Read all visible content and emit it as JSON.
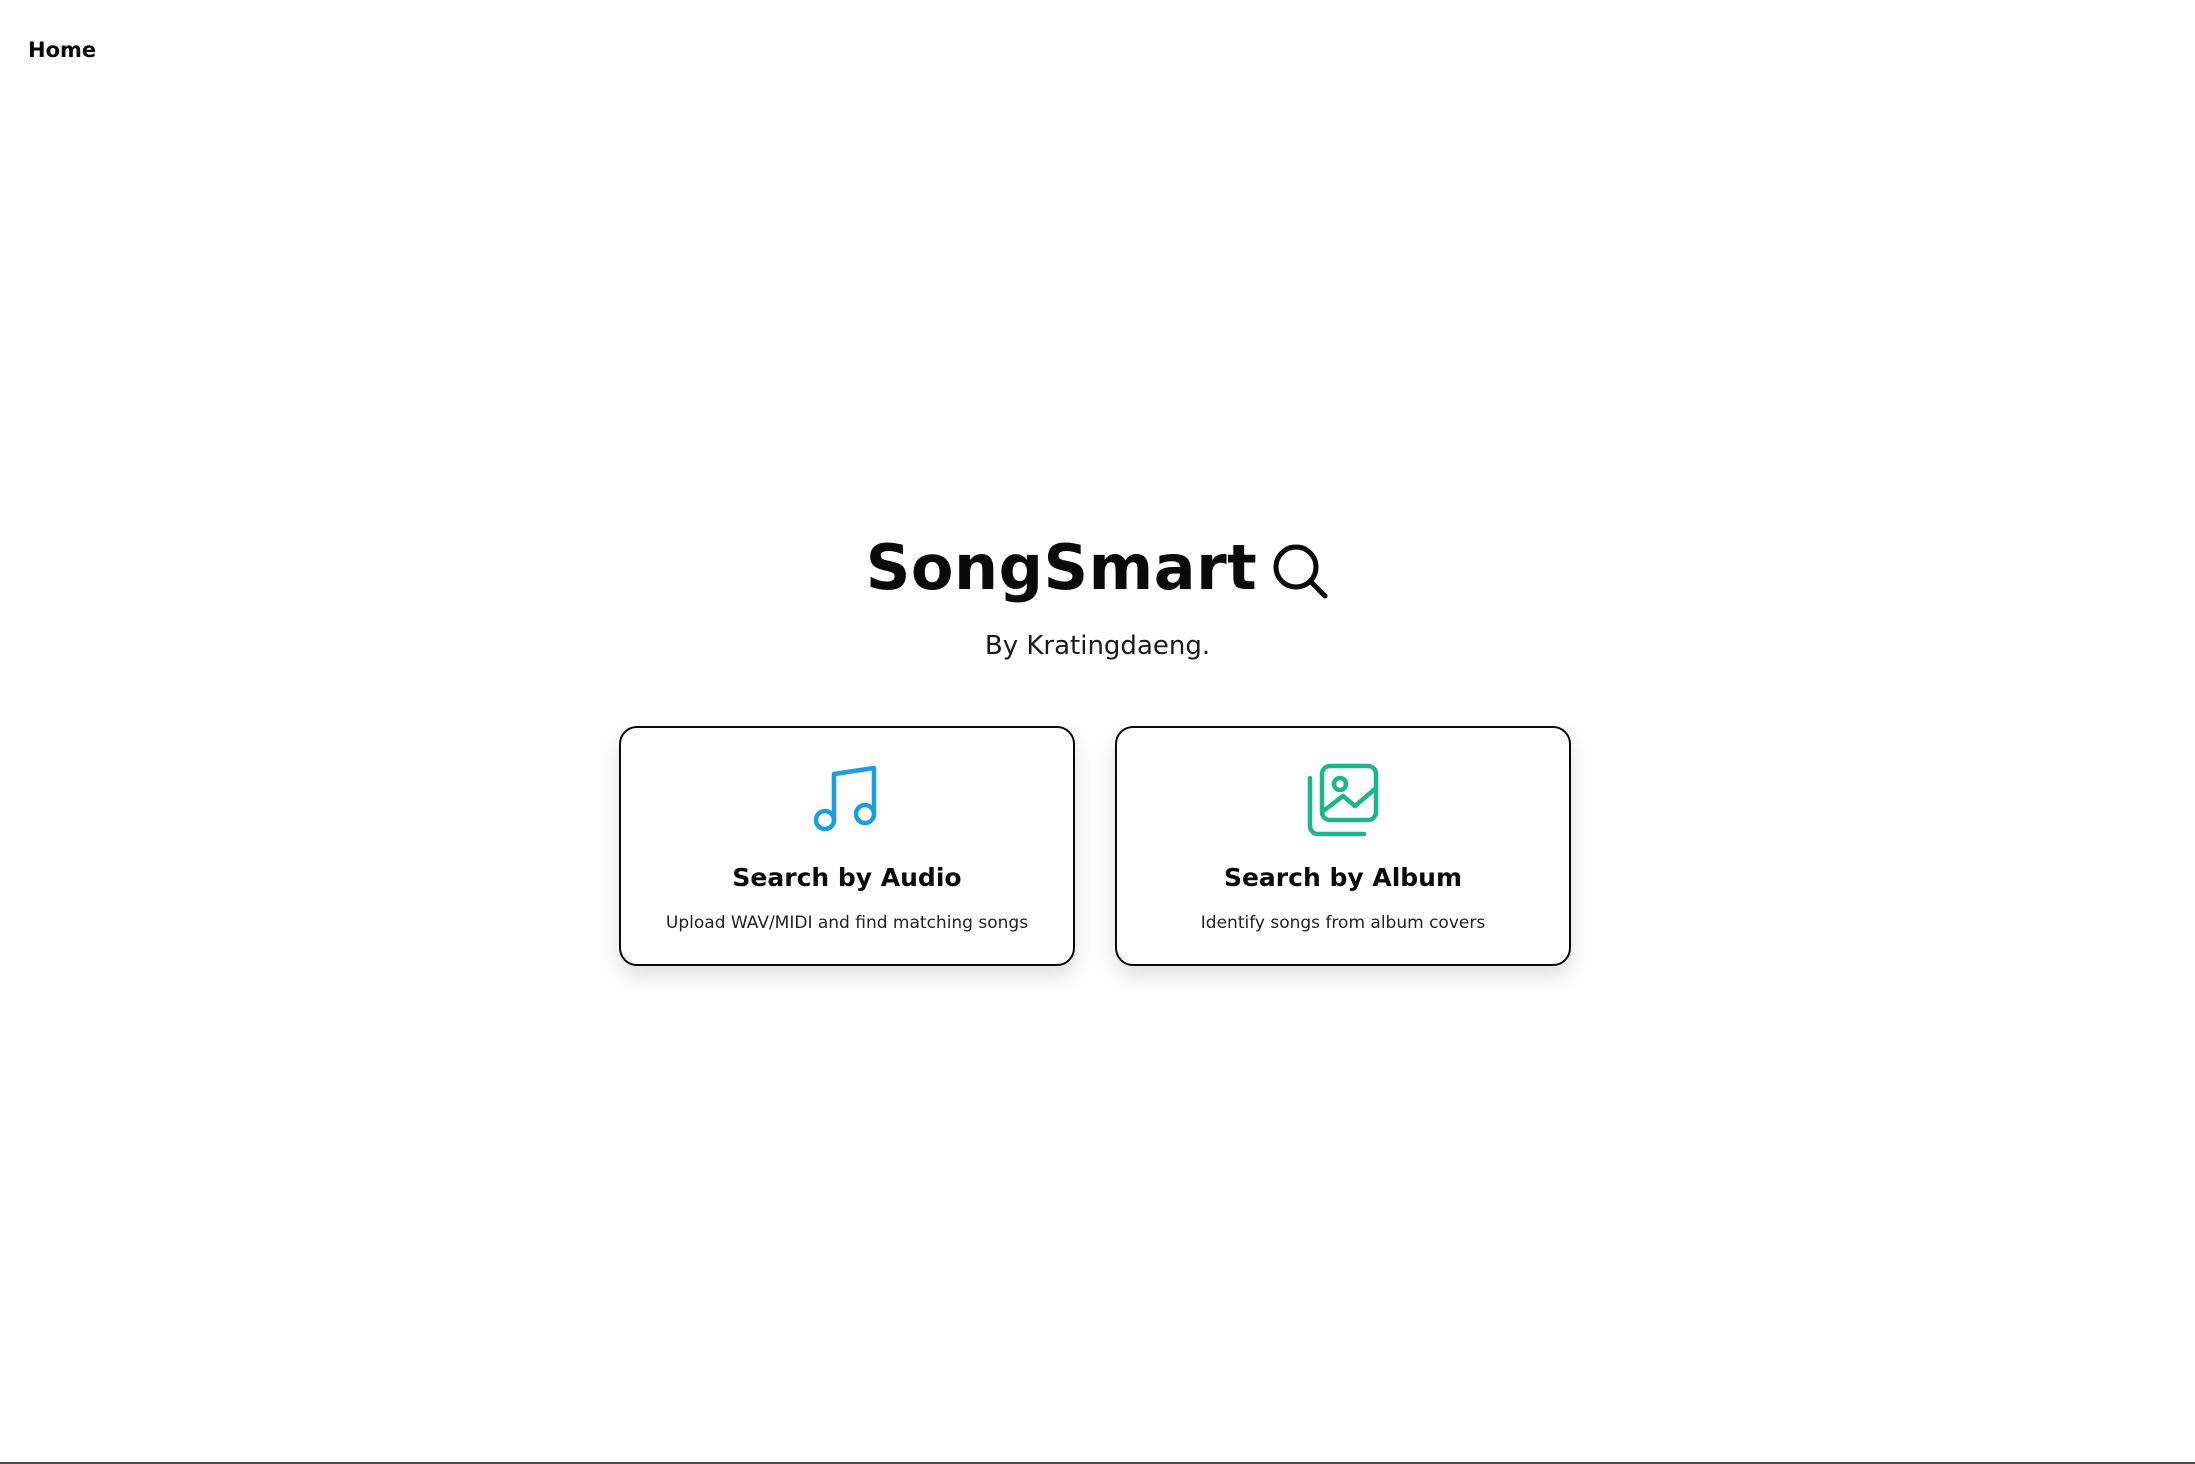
{
  "nav": {
    "home_label": "Home"
  },
  "hero": {
    "title": "SongSmart",
    "title_icon": "search-icon",
    "subtitle": "By Kratingdaeng."
  },
  "cards": [
    {
      "title": "Search by Audio",
      "description": "Upload WAV/MIDI and find matching songs",
      "icon": "music-note-icon",
      "icon_color": "#1a9ee0"
    },
    {
      "title": "Search by Album",
      "description": "Identify songs from album covers",
      "icon": "image-gallery-icon",
      "icon_color": "#1fb58a"
    }
  ]
}
